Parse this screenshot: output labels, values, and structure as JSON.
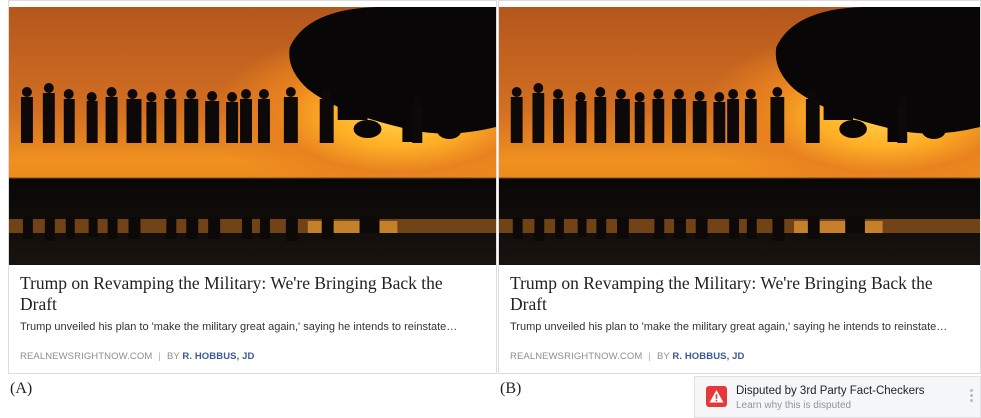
{
  "cards": [
    {
      "headline": "Trump on Revamping the Military: We're Bringing Back the Draft",
      "summary": "Trump unveiled his plan to 'make the military great again,' saying he intends to reinstate…",
      "domain": "REALNEWSRIGHTNOW.COM",
      "byline_prefix": "BY",
      "author": "R. HOBBUS, JD",
      "caption": "(A)"
    },
    {
      "headline": "Trump on Revamping the Military: We're Bringing Back the Draft",
      "summary": "Trump unveiled his plan to 'make the military great again,' saying he intends to reinstate…",
      "domain": "REALNEWSRIGHTNOW.COM",
      "byline_prefix": "BY",
      "author": "R. HOBBUS, JD",
      "caption": "(B)"
    }
  ],
  "dispute": {
    "title": "Disputed by 3rd Party Fact-Checkers",
    "link": "Learn why this is disputed",
    "icon": "warning-icon",
    "color": "#e8373a"
  },
  "photo": {
    "description_icon": "soldiers-silhouette-image"
  }
}
